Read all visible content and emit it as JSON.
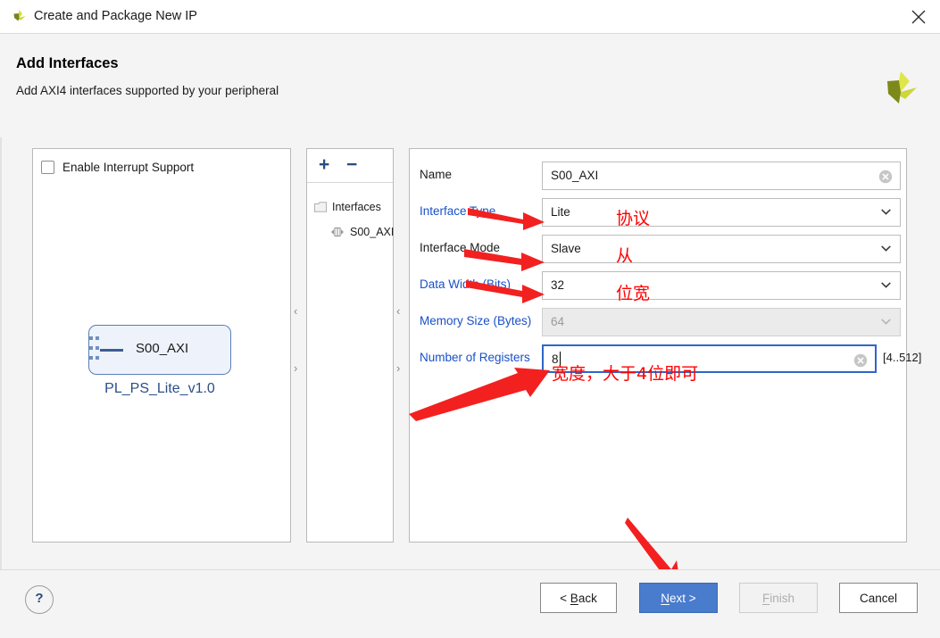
{
  "window": {
    "title": "Create and Package New IP",
    "icon": "xilinx-logo-icon",
    "close_label": "✕"
  },
  "header": {
    "title": "Add Interfaces",
    "subtitle": "Add AXI4 interfaces supported by your peripheral",
    "brand_logo": "xilinx-logo-icon"
  },
  "left_panel": {
    "interrupt_checkbox": {
      "label": "Enable Interrupt Support",
      "checked": false
    },
    "diagram": {
      "block_name": "S00_AXI",
      "caption": "PL_PS_Lite_v1.0"
    }
  },
  "tree_panel": {
    "add_button": "+",
    "remove_button": "−",
    "nodes": [
      {
        "label": "Interfaces",
        "icon": "folder-icon"
      },
      {
        "label": "S00_AXI",
        "icon": "interface-port-icon"
      }
    ]
  },
  "form": {
    "rows": [
      {
        "label": "Name",
        "label_color": "dark",
        "value": "S00_AXI",
        "type": "text",
        "clearable": true,
        "disabled": false,
        "focused": false
      },
      {
        "label": "Interface Type",
        "label_color": "blue",
        "value": "Lite",
        "type": "select",
        "clearable": false,
        "disabled": false,
        "focused": false
      },
      {
        "label": "Interface Mode",
        "label_color": "dark",
        "value": "Slave",
        "type": "select",
        "clearable": false,
        "disabled": false,
        "focused": false
      },
      {
        "label": "Data Width (Bits)",
        "label_color": "blue",
        "value": "32",
        "type": "select",
        "clearable": false,
        "disabled": false,
        "focused": false
      },
      {
        "label": "Memory Size (Bytes)",
        "label_color": "blue",
        "value": "64",
        "type": "select",
        "clearable": false,
        "disabled": true,
        "focused": false
      },
      {
        "label": "Number of Registers",
        "label_color": "blue",
        "value": "8",
        "type": "text",
        "clearable": true,
        "disabled": false,
        "focused": true
      }
    ],
    "registers_range_hint": "[4..512]"
  },
  "annotations": {
    "accent_color": "#ff0000",
    "items": [
      {
        "text": "协议",
        "name": "annotation-protocol"
      },
      {
        "text": "从",
        "name": "annotation-slave"
      },
      {
        "text": "位宽",
        "name": "annotation-bit-width"
      },
      {
        "text": "宽度，大于4位即可",
        "name": "annotation-register-width"
      }
    ]
  },
  "splitters": {
    "collapse_left_icon": "‹",
    "collapse_right_icon": "›"
  },
  "footer": {
    "help_label": "?",
    "buttons": [
      {
        "name": "back-button",
        "prefix": "< ",
        "mnemonic": "B",
        "suffix": "ack",
        "state": "normal"
      },
      {
        "name": "next-button",
        "prefix": "",
        "mnemonic": "N",
        "suffix": "ext >",
        "state": "primary"
      },
      {
        "name": "finish-button",
        "prefix": "",
        "mnemonic": "F",
        "suffix": "inish",
        "state": "disabled"
      },
      {
        "name": "cancel-button",
        "prefix": "",
        "mnemonic": "",
        "suffix": "Cancel",
        "state": "normal"
      }
    ]
  }
}
